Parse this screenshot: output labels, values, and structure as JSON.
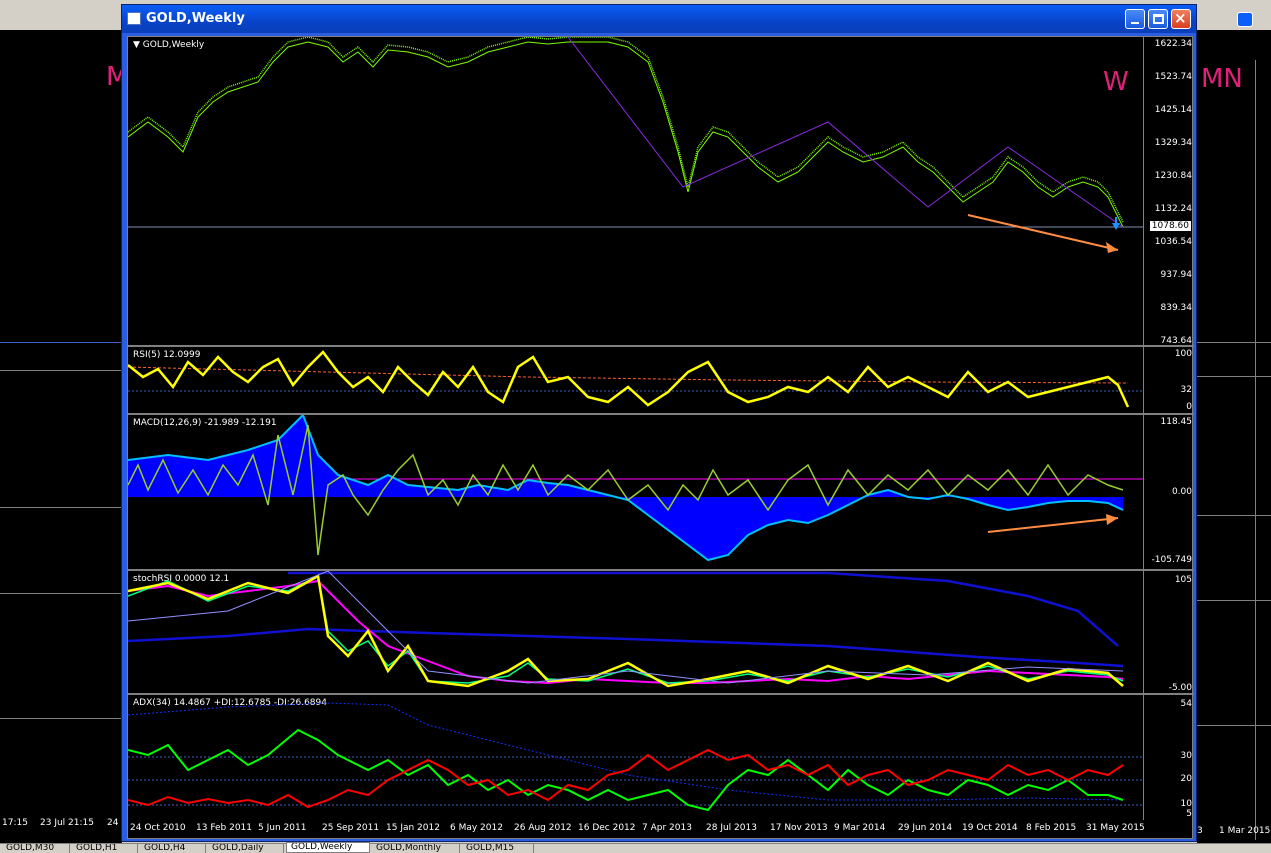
{
  "window": {
    "title": "GOLD,Weekly",
    "chart_label": "GOLD,Weekly",
    "timeframe_letter": "W",
    "current_price": "1078.60",
    "price_scale": [
      "1622.34",
      "1523.74",
      "1425.14",
      "1329.34",
      "1230.84",
      "1132.24",
      "1036.54",
      "937.94",
      "839.34",
      "743.64"
    ]
  },
  "rsi": {
    "label": "RSI(5) 12.0999",
    "scale": [
      "100",
      "32",
      "0"
    ]
  },
  "macd": {
    "label": "MACD(12,26,9) -21.989 -12.191",
    "scale": [
      "118.45",
      "0.00",
      "-105.749"
    ]
  },
  "stoch": {
    "label": "stochRSI 0.0000 12.1",
    "scale": [
      "105",
      "-5.00"
    ]
  },
  "adx": {
    "label": "ADX(34) 14.4867 +DI:12.6785 -DI:26.6894",
    "scale": [
      "54",
      "30",
      "20",
      "10",
      "5"
    ]
  },
  "dates": [
    "24 Oct 2010",
    "13 Feb 2011",
    "5 Jun 2011",
    "25 Sep 2011",
    "15 Jan 2012",
    "6 May 2012",
    "26 Aug 2012",
    "16 Dec 2012",
    "7 Apr 2013",
    "28 Jul 2013",
    "17 Nov 2013",
    "9 Mar 2014",
    "29 Jun 2014",
    "19 Oct 2014",
    "8 Feb 2015",
    "31 May 2015"
  ],
  "left_window": {
    "letter": "M",
    "dates": [
      "17:15",
      "23 Jul 21:15",
      "24"
    ]
  },
  "right_window": {
    "letter": "MN",
    "dates": [
      "3",
      "1 Mar 2015"
    ]
  },
  "tabs": [
    "GOLD,M30",
    "GOLD,H1",
    "GOLD,H4",
    "GOLD,Daily",
    "GOLD,Weekly",
    "GOLD,Monthly",
    "GOLD,M15"
  ],
  "colors": {
    "bull_candle": "#7cfc00",
    "rsi_line": "#ffff00",
    "macd_hist": "#0000ff",
    "adx_plus": "#00ff00",
    "adx_minus": "#ff0000",
    "arrow": "#ff8c40",
    "titlebar": "#0a5ff8"
  }
}
